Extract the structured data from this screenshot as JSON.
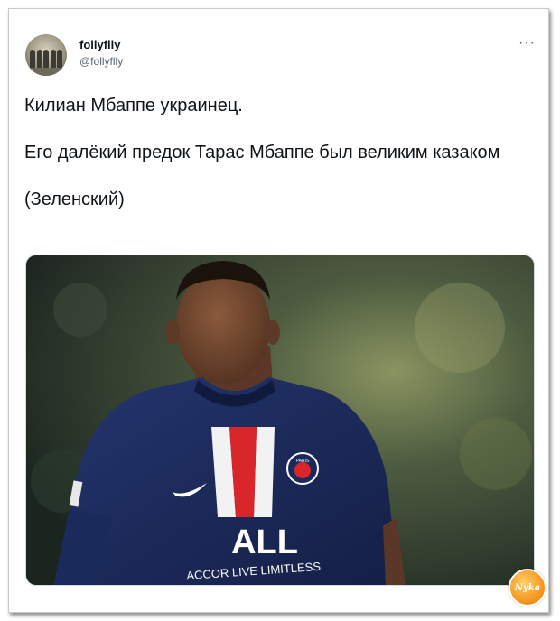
{
  "author": {
    "display_name": "follyflly",
    "handle": "@follyflly"
  },
  "menu_icon": "more-horizontal-icon",
  "tweet": {
    "line1": "Килиан Мбаппе украинец.",
    "line2": "Его далёкий предок Тарас Мбаппе был великим казаком",
    "line3": "(Зеленский)"
  },
  "photo": {
    "jersey_text": "ACCOR LIVE LIMITLESS",
    "jersey_brand": "ALL",
    "badge_text": "PARIS"
  },
  "watermark": {
    "text": "Nyka"
  },
  "colors": {
    "text": "#0f1419",
    "secondary": "#536471",
    "jersey": "#1b2a5c",
    "stripe_red": "#d9262a",
    "watermark": "#f59a23"
  }
}
